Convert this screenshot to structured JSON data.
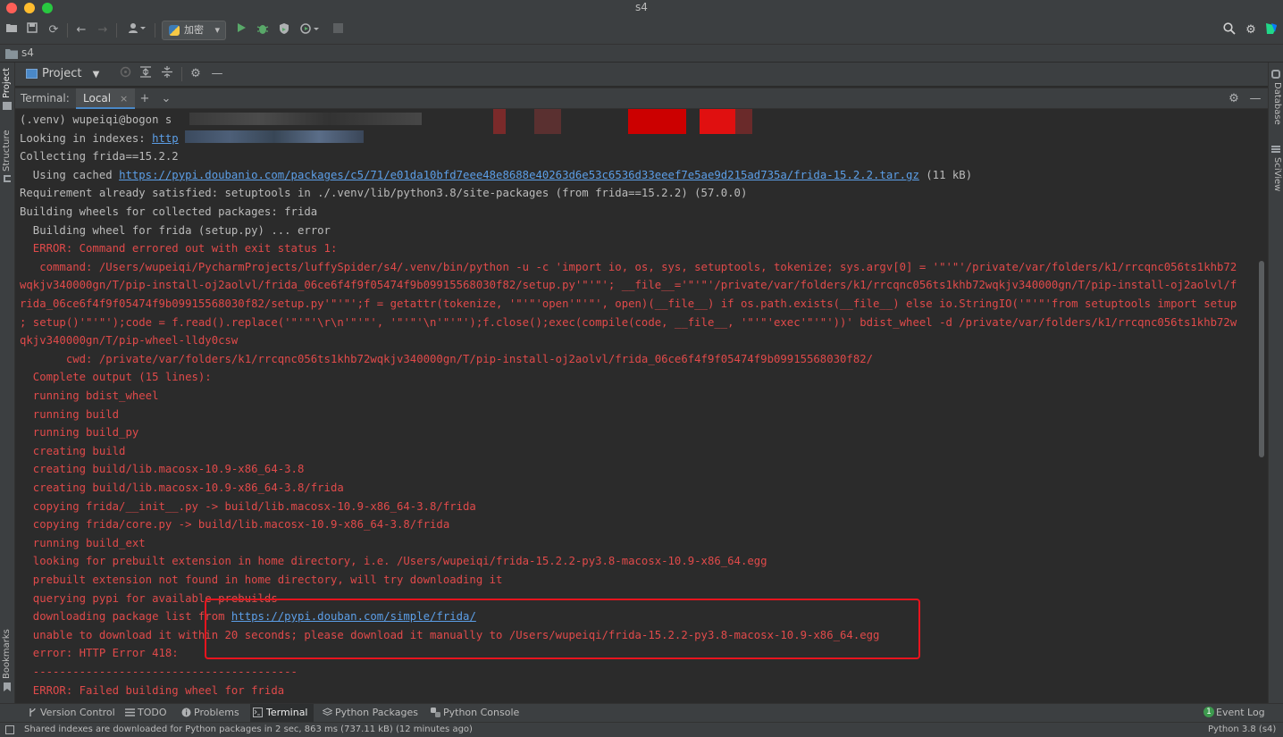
{
  "window": {
    "title": "s4"
  },
  "toolbar": {
    "run_config": "加密"
  },
  "navbar": {
    "path": "s4"
  },
  "left_strip": {
    "project": "Project",
    "structure": "Structure",
    "bookmarks": "Bookmarks"
  },
  "right_strip": {
    "database": "Database",
    "sciview": "SciView"
  },
  "project_panel": {
    "selector": "Project"
  },
  "terminal": {
    "label": "Terminal:",
    "tab": "Local",
    "lines": [
      {
        "t": "(.venv) wupeiqi@bogon s",
        "cls": ""
      },
      {
        "t": "Looking in indexes: ",
        "link": "http",
        "cls": ""
      },
      {
        "t": "Collecting frida==15.2.2",
        "cls": ""
      },
      {
        "t": "  Using cached ",
        "link": "https://pypi.doubanio.com/packages/c5/71/e01da10bfd7eee48e8688e40263d6e53c6536d33eeef7e5ae9d215ad735a/frida-15.2.2.tar.gz",
        "after": " (11 kB)",
        "cls": ""
      },
      {
        "t": "Requirement already satisfied: setuptools in ./.venv/lib/python3.8/site-packages (from frida==15.2.2) (57.0.0)",
        "cls": ""
      },
      {
        "t": "Building wheels for collected packages: frida",
        "cls": ""
      },
      {
        "t": "  Building wheel for frida (setup.py) ... error",
        "cls": ""
      },
      {
        "t": "  ERROR: Command errored out with exit status 1:",
        "cls": "err"
      },
      {
        "t": "   command: /Users/wupeiqi/PycharmProjects/luffySpider/s4/.venv/bin/python -u -c 'import io, os, sys, setuptools, tokenize; sys.argv[0] = '\"'\"'/private/var/folders/k1/rrcqnc056ts1khb72",
        "cls": "err"
      },
      {
        "t": "wqkjv340000gn/T/pip-install-oj2aolvl/frida_06ce6f4f9f05474f9b09915568030f82/setup.py'\"'\"'; __file__='\"'\"'/private/var/folders/k1/rrcqnc056ts1khb72wqkjv340000gn/T/pip-install-oj2aolvl/f",
        "cls": "err"
      },
      {
        "t": "rida_06ce6f4f9f05474f9b09915568030f82/setup.py'\"'\"';f = getattr(tokenize, '\"'\"'open'\"'\"', open)(__file__) if os.path.exists(__file__) else io.StringIO('\"'\"'from setuptools import setup",
        "cls": "err"
      },
      {
        "t": "; setup()'\"'\"');code = f.read().replace('\"'\"'\\r\\n'\"'\"', '\"'\"'\\n'\"'\"');f.close();exec(compile(code, __file__, '\"'\"'exec'\"'\"'))' bdist_wheel -d /private/var/folders/k1/rrcqnc056ts1khb72w",
        "cls": "err"
      },
      {
        "t": "qkjv340000gn/T/pip-wheel-lldy0csw",
        "cls": "err"
      },
      {
        "t": "       cwd: /private/var/folders/k1/rrcqnc056ts1khb72wqkjv340000gn/T/pip-install-oj2aolvl/frida_06ce6f4f9f05474f9b09915568030f82/",
        "cls": "err"
      },
      {
        "t": "  Complete output (15 lines):",
        "cls": "err"
      },
      {
        "t": "  running bdist_wheel",
        "cls": "err"
      },
      {
        "t": "  running build",
        "cls": "err"
      },
      {
        "t": "  running build_py",
        "cls": "err"
      },
      {
        "t": "  creating build",
        "cls": "err"
      },
      {
        "t": "  creating build/lib.macosx-10.9-x86_64-3.8",
        "cls": "err"
      },
      {
        "t": "  creating build/lib.macosx-10.9-x86_64-3.8/frida",
        "cls": "err"
      },
      {
        "t": "  copying frida/__init__.py -> build/lib.macosx-10.9-x86_64-3.8/frida",
        "cls": "err"
      },
      {
        "t": "  copying frida/core.py -> build/lib.macosx-10.9-x86_64-3.8/frida",
        "cls": "err"
      },
      {
        "t": "  running build_ext",
        "cls": "err"
      },
      {
        "t": "  looking for prebuilt extension in home directory, i.e. /Users/wupeiqi/frida-15.2.2-py3.8-macosx-10.9-x86_64.egg",
        "cls": "err"
      },
      {
        "t": "  prebuilt extension not found in home directory, will try downloading it",
        "cls": "err"
      },
      {
        "t": "  querying pypi for available prebuilds",
        "cls": "err"
      },
      {
        "t": "  downloading package list from ",
        "link": "https://pypi.douban.com/simple/frida/",
        "cls": "err"
      },
      {
        "t": "  unable to download it within 20 seconds; please download it manually to /Users/wupeiqi/frida-15.2.2-py3.8-macosx-10.9-x86_64.egg",
        "cls": "err"
      },
      {
        "t": "  error: HTTP Error 418:",
        "cls": "err"
      },
      {
        "t": "  ----------------------------------------",
        "cls": "err"
      },
      {
        "t": "  ERROR: Failed building wheel for frida",
        "cls": "err"
      }
    ]
  },
  "bottom_tabs": [
    {
      "label": "Version Control",
      "icon": "branch-icon"
    },
    {
      "label": "TODO",
      "icon": "list-icon"
    },
    {
      "label": "Problems",
      "icon": "info-icon"
    },
    {
      "label": "Terminal",
      "icon": "terminal-icon"
    },
    {
      "label": "Python Packages",
      "icon": "layers-icon"
    },
    {
      "label": "Python Console",
      "icon": "python-icon"
    }
  ],
  "event_log": {
    "label": "Event Log",
    "count": "1"
  },
  "status": {
    "message": "Shared indexes are downloaded for Python packages in 2 sec, 863 ms (737.11 kB) (12 minutes ago)",
    "interpreter": "Python 3.8 (s4)"
  },
  "colors": {
    "accent": "#4a88c7",
    "error_text": "#e04a4a",
    "link": "#5c9fe8",
    "highlight_box": "#e8141e"
  }
}
